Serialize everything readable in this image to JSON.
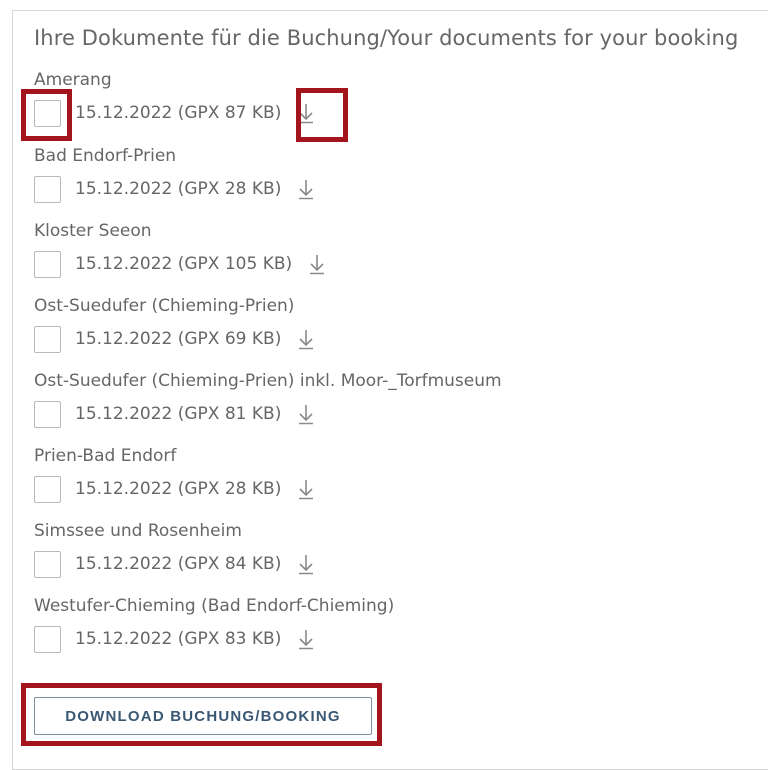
{
  "panel": {
    "title": "Ihre Dokumente für die Buchung/Your documents for your booking"
  },
  "documents": [
    {
      "name": "Amerang",
      "meta": "15.12.2022 (GPX 87 KB)",
      "checked": false
    },
    {
      "name": "Bad Endorf-Prien",
      "meta": "15.12.2022 (GPX 28 KB)",
      "checked": false
    },
    {
      "name": "Kloster Seeon",
      "meta": "15.12.2022 (GPX 105 KB)",
      "checked": false
    },
    {
      "name": "Ost-Suedufer (Chieming-Prien)",
      "meta": "15.12.2022 (GPX 69 KB)",
      "checked": false
    },
    {
      "name": "Ost-Suedufer (Chieming-Prien) inkl. Moor-_Torfmuseum",
      "meta": "15.12.2022 (GPX 81 KB)",
      "checked": false
    },
    {
      "name": "Prien-Bad Endorf",
      "meta": "15.12.2022 (GPX 28 KB)",
      "checked": false
    },
    {
      "name": "Simssee und Rosenheim",
      "meta": "15.12.2022 (GPX 84 KB)",
      "checked": false
    },
    {
      "name": "Westufer-Chieming (Bad Endorf-Chieming)",
      "meta": "15.12.2022 (GPX 83 KB)",
      "checked": false
    }
  ],
  "actions": {
    "download_label": "DOWNLOAD BUCHUNG/BOOKING"
  },
  "icons": {
    "download": "download-arrow-icon"
  },
  "colors": {
    "highlight": "#a4141c",
    "button_text": "#3a5874",
    "text": "#666666"
  }
}
